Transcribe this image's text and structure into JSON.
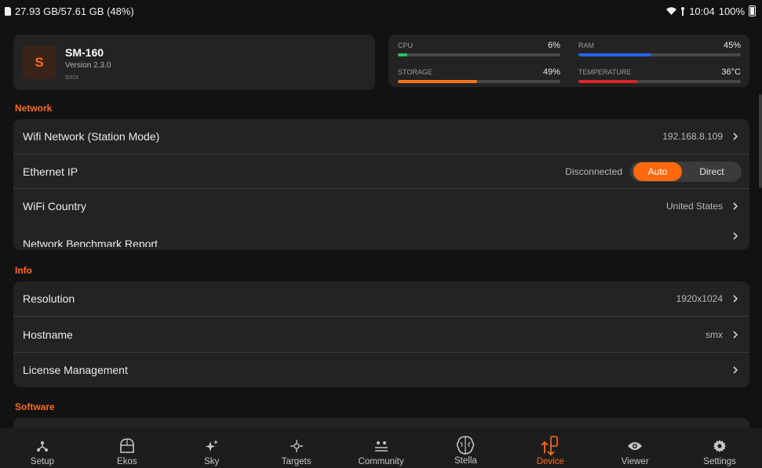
{
  "status_bar": {
    "storage": "27.93 GB/57.61 GB (48%)",
    "time": "10:04",
    "battery": "100%"
  },
  "device": {
    "initial": "S",
    "name": "SM-160",
    "version": "Version 2.3.0",
    "hostname": "smx"
  },
  "stats": [
    {
      "label": "CPU",
      "value": "6%",
      "percent": 6,
      "color": "#22c55e"
    },
    {
      "label": "RAM",
      "value": "45%",
      "percent": 45,
      "color": "#2563eb"
    },
    {
      "label": "STORAGE",
      "value": "49%",
      "percent": 49,
      "color": "#f97316"
    },
    {
      "label": "TEMPERATURE",
      "value": "36°C",
      "percent": 36,
      "color": "#dc2626"
    }
  ],
  "sections": {
    "network": "Network",
    "info": "Info",
    "software": "Software"
  },
  "network_rows": {
    "wifi": {
      "label": "Wifi Network (Station Mode)",
      "value": "192.168.8.109"
    },
    "ethernet": {
      "label": "Ethernet IP",
      "value": "Disconnected",
      "toggle": [
        "Auto",
        "Direct"
      ],
      "selected": "Auto"
    },
    "country": {
      "label": "WiFi Country",
      "value": "United States"
    },
    "benchmark": {
      "label": "Network Benchmark Report"
    }
  },
  "info_rows": {
    "resolution": {
      "label": "Resolution",
      "value": "1920x1024"
    },
    "hostname": {
      "label": "Hostname",
      "value": "smx"
    },
    "license": {
      "label": "License Management"
    }
  },
  "nav": {
    "active": "Device",
    "items": [
      "Setup",
      "Ekos",
      "Sky",
      "Targets",
      "Community",
      "Stella",
      "Device",
      "Viewer",
      "Settings"
    ]
  },
  "colors": {
    "accent": "#ff6a1a",
    "background": "#121212",
    "card": "#232323"
  }
}
